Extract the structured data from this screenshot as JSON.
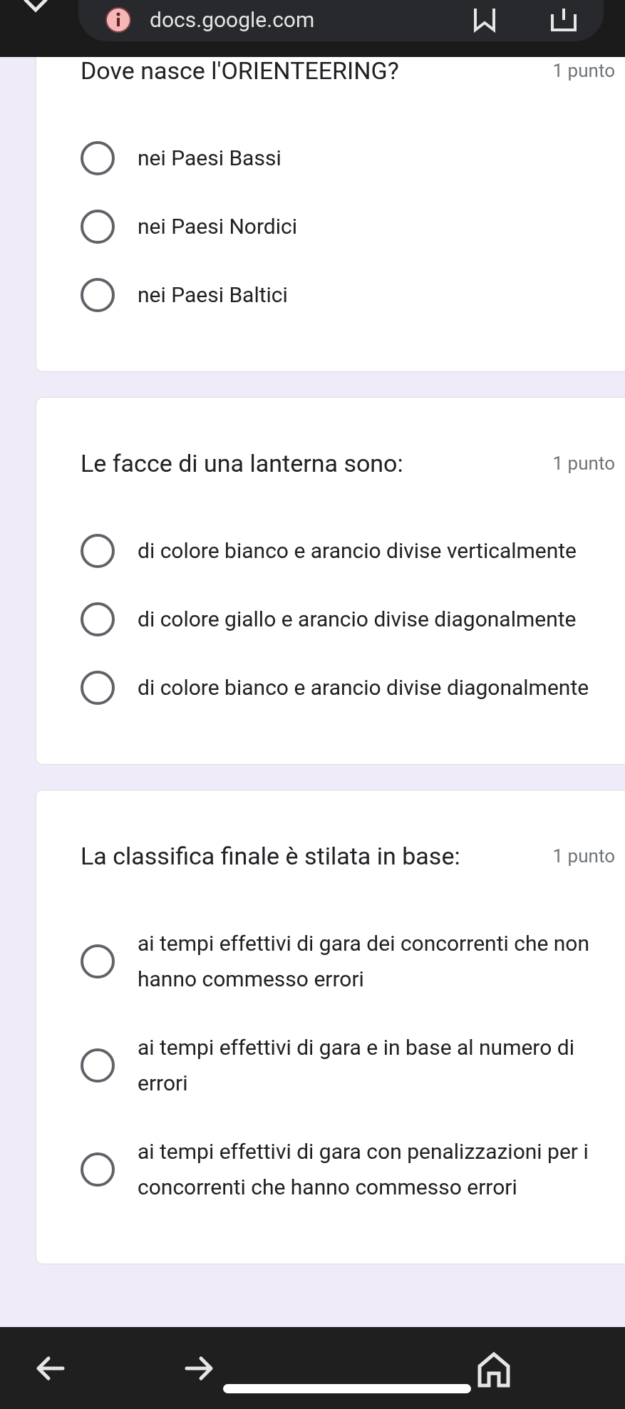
{
  "browser_bar": {
    "url": "docs.google.com"
  },
  "questions": [
    {
      "title": "Dove nasce l'ORIENTEERING?",
      "points": "1 punto",
      "options": [
        {
          "label": "nei Paesi Bassi",
          "selected": false
        },
        {
          "label": "nei Paesi Nordici",
          "selected": false
        },
        {
          "label": "nei Paesi Baltici",
          "selected": false
        }
      ]
    },
    {
      "title": "Le facce di una lanterna sono:",
      "points": "1 punto",
      "options": [
        {
          "label": "di colore bianco e arancio divise verticalmente",
          "selected": false
        },
        {
          "label": "di colore giallo e arancio divise diagonalmente",
          "selected": false
        },
        {
          "label": "di colore bianco e arancio divise diagonalmente",
          "selected": false
        }
      ]
    },
    {
      "title": "La classifica finale è stilata in base:",
      "points": "1 punto",
      "options": [
        {
          "label": "ai tempi effettivi di gara dei concorrenti che non hanno commesso errori",
          "selected": false
        },
        {
          "label": "ai tempi effettivi di gara e in base al numero di errori",
          "selected": false
        },
        {
          "label": "ai tempi effettivi di gara con penalizzazioni per i concorrenti che hanno commesso errori",
          "selected": false
        }
      ]
    }
  ]
}
